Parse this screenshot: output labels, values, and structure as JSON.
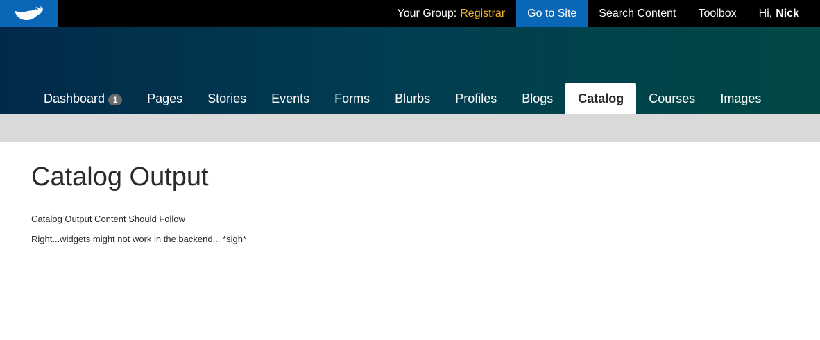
{
  "topbar": {
    "logo_icon": "whale-icon",
    "group_label": "Your Group:",
    "group_name": "Registrar",
    "go_to_site": "Go to Site",
    "search_content": "Search Content",
    "toolbox": "Toolbox",
    "greeting": "Hi,",
    "user_name": "Nick"
  },
  "tabs": [
    {
      "label": "Dashboard",
      "badge": "1"
    },
    {
      "label": "Pages"
    },
    {
      "label": "Stories"
    },
    {
      "label": "Events"
    },
    {
      "label": "Forms"
    },
    {
      "label": "Blurbs"
    },
    {
      "label": "Profiles"
    },
    {
      "label": "Blogs"
    },
    {
      "label": "Catalog",
      "active": true
    },
    {
      "label": "Courses"
    },
    {
      "label": "Images"
    }
  ],
  "main": {
    "title": "Catalog Output",
    "paragraphs": [
      "Catalog Output Content Should Follow",
      "Right...widgets might not work in the backend... *sigh*"
    ]
  },
  "colors": {
    "accent_blue": "#0a67b8",
    "group_accent": "#f5b623",
    "header_gradient_start": "#012a4a",
    "header_gradient_end": "#014844",
    "subbar": "#d9d9d9"
  }
}
